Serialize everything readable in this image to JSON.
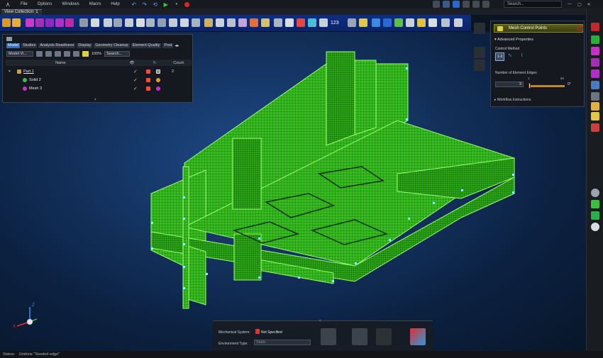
{
  "menubar": {
    "items": [
      "File",
      "Options",
      "Windows",
      "Macro",
      "Help"
    ],
    "search_placeholder": "Search..."
  },
  "tabs": {
    "active": "View Collection: 1"
  },
  "toolbar": {
    "numeric_button": "123"
  },
  "tree": {
    "tabs": [
      "Model",
      "Studies",
      "Analysis Readiness",
      "Display",
      "Geometry Cleanup",
      "Element Quality",
      "Post"
    ],
    "view_select": "Model Vi...",
    "zoom": "100%",
    "search_label": "Search...",
    "columns": {
      "name": "Name",
      "count": "Count"
    },
    "rows": [
      {
        "name": "Part 1",
        "count": "2",
        "color": "#ff4a3a"
      },
      {
        "name": "Solid 2",
        "count": "",
        "color": "#ff4a3a"
      },
      {
        "name": "Mesh 3",
        "count": "",
        "color": "#ff4a3a"
      }
    ]
  },
  "props": {
    "title": "Mesh Control Points",
    "section_advanced": "Advanced Properties",
    "control_method": "Control Method",
    "method_button": "1-3",
    "num_edges_label": "Number of Element Edges",
    "slider_min": "1",
    "slider_max": "50",
    "edges_value": "3",
    "angle_value": "0°",
    "section_workflow": "Workflow Instructions"
  },
  "bottom": {
    "mech_label": "Mechanical System:",
    "mech_value": "Not Specified",
    "env_label": "Environment Type:",
    "env_value": "Static"
  },
  "axis": {
    "z": "Z",
    "x": "X"
  },
  "status": {
    "label": "Status:",
    "text": "Undone \"Seeded edge\""
  },
  "colors": {
    "mesh": "#39c91c",
    "mesh_edges": "#8fff6a",
    "toolbar": "#0c2f86",
    "accent": "#2f6fc4"
  }
}
